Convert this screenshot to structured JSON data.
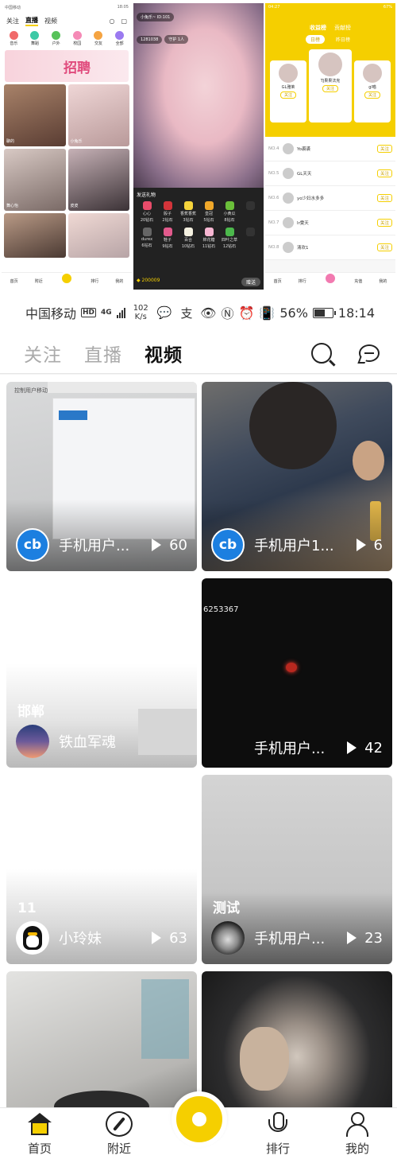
{
  "collage": {
    "shot1": {
      "time": "18:05",
      "tabs": [
        "关注",
        "直播",
        "视频"
      ],
      "categories": [
        "音乐",
        "舞蹈",
        "户外",
        "校园",
        "交友",
        "全部"
      ],
      "banner_text": "招聘",
      "cells": [
        "聊的",
        "小兔乐",
        "舞心怡",
        "皮皮",
        "",
        ""
      ],
      "nav": [
        "首页",
        "附近",
        "",
        "排行",
        "我的"
      ]
    },
    "shot2": {
      "host": "小兔乐~",
      "host_id": "ID:101",
      "viewers": "1281038",
      "guard": "守护 1人",
      "gift_title": "发送礼物",
      "gifts": [
        {
          "name": "心心",
          "price": "20钻石"
        },
        {
          "name": "骰子",
          "price": "2钻石"
        },
        {
          "name": "香蕉香蕉",
          "price": "3钻石"
        },
        {
          "name": "皇冠",
          "price": "5钻石"
        },
        {
          "name": "小黄瓜",
          "price": "8钻石"
        },
        {
          "name": "",
          "price": ""
        },
        {
          "name": "durex",
          "price": "6钻石"
        },
        {
          "name": "鞋子",
          "price": "9钻石"
        },
        {
          "name": "百合",
          "price": "10钻石"
        },
        {
          "name": "棉花糖",
          "price": "11钻石"
        },
        {
          "name": "四叶之草",
          "price": "12钻石"
        },
        {
          "name": "",
          "price": ""
        }
      ],
      "balance": "200009",
      "send": "赠送"
    },
    "shot3": {
      "time": "04:27",
      "battery": "67%",
      "tabs": [
        "收益榜",
        "贡献榜"
      ],
      "sub_tabs": [
        "日榜",
        "昨日榜"
      ],
      "podium": [
        {
          "name": "GL雅茉",
          "btn": "关注"
        },
        {
          "name": "TJ果果法克",
          "btn": "关注"
        },
        {
          "name": "gl喵",
          "btn": "关注"
        }
      ],
      "rows": [
        {
          "no": "NO.4",
          "name": "Yo裘裘",
          "btn": "关注"
        },
        {
          "no": "NO.5",
          "name": "GL天天",
          "btn": "关注"
        },
        {
          "no": "NO.6",
          "name": "yo少妇水多多",
          "btn": "关注"
        },
        {
          "no": "NO.7",
          "name": "lr雯天",
          "btn": "关注"
        },
        {
          "no": "NO.8",
          "name": "清欢1",
          "btn": "关注"
        }
      ],
      "nav": [
        "首页",
        "排行",
        "",
        "充值",
        "我的"
      ]
    }
  },
  "status_bar": {
    "carrier": "中国移动",
    "hd": "HD",
    "net": "4G",
    "speed_value": "102",
    "speed_unit": "K/s",
    "battery": "56%",
    "time": "18:14"
  },
  "top_nav": {
    "tabs": [
      {
        "label": "关注",
        "active": false
      },
      {
        "label": "直播",
        "active": false
      },
      {
        "label": "视频",
        "active": true
      }
    ]
  },
  "feed": [
    {
      "title": "",
      "user": "手机用户...",
      "count": "60",
      "avatar": "cb",
      "overlay": "控制用户移动"
    },
    {
      "title": "",
      "user": "手机用户1...",
      "count": "6",
      "avatar": "cb",
      "overlay": ""
    },
    {
      "title": "邯郸",
      "user": "铁血军魂",
      "count": "",
      "avatar": "dusk",
      "overlay": ""
    },
    {
      "title": "",
      "user": "手机用户...",
      "count": "42",
      "avatar": "none",
      "overlay": "6253367"
    },
    {
      "title": "11",
      "user": "小玲妹",
      "count": "63",
      "avatar": "qq",
      "overlay": ""
    },
    {
      "title": "测试",
      "user": "手机用户...",
      "count": "23",
      "avatar": "car",
      "overlay": ""
    },
    {
      "title": "",
      "user": "",
      "count": "",
      "avatar": "none",
      "overlay": ""
    },
    {
      "title": "",
      "user": "",
      "count": "",
      "avatar": "none",
      "overlay": ""
    }
  ],
  "bottom_nav": {
    "items": [
      "首页",
      "附近",
      "排行",
      "我的"
    ]
  },
  "colors": {
    "accent": "#f5cf00",
    "text": "#111111",
    "inactive_tab": "#aaaaaa"
  }
}
